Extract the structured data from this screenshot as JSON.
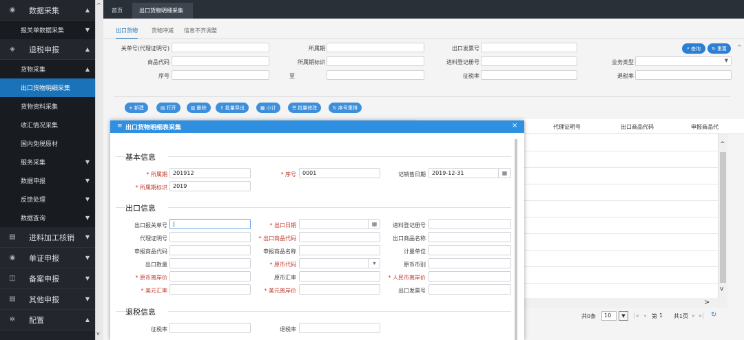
{
  "sidebar": {
    "items": [
      {
        "label": "数据采集",
        "type": "top",
        "icon": "database-icon",
        "arrow": "▲"
      },
      {
        "label": "报关单数据采集",
        "type": "sub",
        "arrow": "▼"
      },
      {
        "label": "退税申报",
        "type": "top",
        "icon": "cube-icon",
        "arrow": "▲"
      },
      {
        "label": "货物采集",
        "type": "sub",
        "arrow": "▲"
      },
      {
        "label": "出口货物明细采集",
        "type": "sub",
        "active": true
      },
      {
        "label": "货物资料采集",
        "type": "sub"
      },
      {
        "label": "收汇情况采集",
        "type": "sub"
      },
      {
        "label": "国内免税原材",
        "type": "sub"
      },
      {
        "label": "服务采集",
        "type": "sub",
        "arrow": "▼"
      },
      {
        "label": "数据申报",
        "type": "sub",
        "arrow": "▼"
      },
      {
        "label": "反馈处理",
        "type": "sub",
        "arrow": "▼"
      },
      {
        "label": "数据查询",
        "type": "sub",
        "arrow": "▼"
      },
      {
        "label": "进料加工核销",
        "type": "top",
        "icon": "doc-icon",
        "arrow": "▼"
      },
      {
        "label": "单证申报",
        "type": "top",
        "icon": "database-icon",
        "arrow": "▼"
      },
      {
        "label": "备案申报",
        "type": "top",
        "icon": "book-icon",
        "arrow": "▼"
      },
      {
        "label": "其他申报",
        "type": "top",
        "icon": "doc-icon",
        "arrow": "▼"
      },
      {
        "label": "配置",
        "type": "top",
        "icon": "gear-icon",
        "arrow": "▲"
      }
    ]
  },
  "tabs": {
    "home": "首页",
    "current": "出口货物明细采集",
    "close": "×"
  },
  "subtabs": [
    "出口货物",
    "货物冲减",
    "信息不齐调整"
  ],
  "search": {
    "fields": [
      {
        "label": "关单号(代理证明号)"
      },
      {
        "label": "所属期"
      },
      {
        "label": "出口发票号"
      },
      {
        "label": "商品代码"
      },
      {
        "label": "所属期标识"
      },
      {
        "label": "进料登记册号"
      },
      {
        "label": "业务类型"
      },
      {
        "label": "序号"
      },
      {
        "label": "至"
      },
      {
        "label": "征税率"
      },
      {
        "label": "退税率"
      }
    ],
    "query_label": "查询",
    "reset_label": "重置"
  },
  "toolbar": [
    "新建",
    "打开",
    "删除",
    "批量导出",
    "小计",
    "批量修改",
    "序号重排"
  ],
  "grid": {
    "headers": [
      "代理证明号",
      "出口商品代码",
      "申报商品代"
    ]
  },
  "pager": {
    "total": "共0条",
    "page_size": "10",
    "page_label": "第",
    "page_num": "1",
    "total_pages": "共1页"
  },
  "modal": {
    "title": "出口货物明细表采集",
    "close": "×",
    "basic_title": "基本信息",
    "export_title": "出口信息",
    "refund_title": "退税信息",
    "basic": {
      "period_label": "* 所属期",
      "period_value": "201912",
      "seq_label": "* 序号",
      "seq_value": "0001",
      "sale_date_label": "记销售日期",
      "sale_date_value": "2019-12-31",
      "period_flag_label": "* 所属期标识",
      "period_flag_value": "2019"
    },
    "export_labels": [
      "出口报关单号",
      "* 出口日期",
      "进料登记册号",
      "代理证明号",
      "* 出口商品代码",
      "出口商品名称",
      "申报商品代码",
      "申报商品名称",
      "计量单位",
      "出口数量",
      "* 原币代码",
      "原币币别",
      "* 原币离岸价",
      "原币汇率",
      "* 人民币离岸价",
      "* 美元汇率",
      "* 美元离岸价",
      "出口发票号"
    ],
    "refund_labels": [
      "征税率",
      "退税率"
    ]
  },
  "colors": {
    "accent": "#1a73b8",
    "modal_header": "#2f8fe0",
    "required": "#c0392b"
  }
}
